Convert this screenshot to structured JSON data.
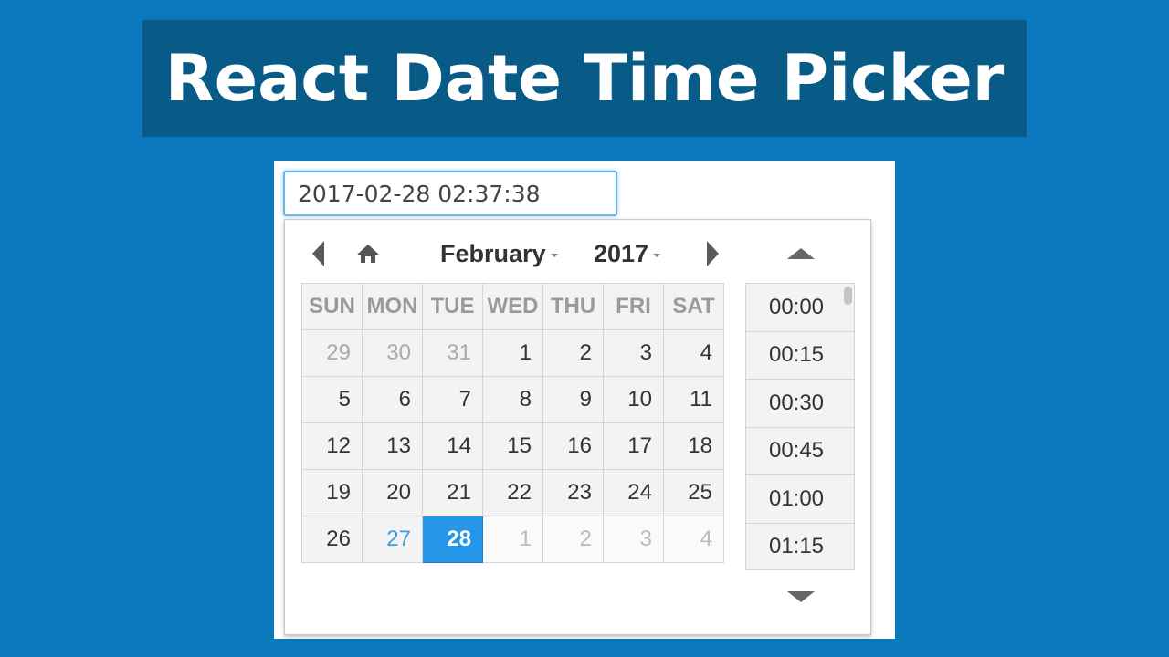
{
  "banner": {
    "title": "React Date Time Picker"
  },
  "input": {
    "value": "2017-02-28 02:37:38"
  },
  "header": {
    "month": "February",
    "year": "2017"
  },
  "calendar": {
    "weekdays": [
      "SUN",
      "MON",
      "TUE",
      "WED",
      "THU",
      "FRI",
      "SAT"
    ],
    "rows": [
      [
        "29",
        "30",
        "31",
        "1",
        "2",
        "3",
        "4"
      ],
      [
        "5",
        "6",
        "7",
        "8",
        "9",
        "10",
        "11"
      ],
      [
        "12",
        "13",
        "14",
        "15",
        "16",
        "17",
        "18"
      ],
      [
        "19",
        "20",
        "21",
        "22",
        "23",
        "24",
        "25"
      ],
      [
        "26",
        "27",
        "28",
        "1",
        "2",
        "3",
        "4"
      ]
    ],
    "today": "27",
    "selected": "28"
  },
  "times": [
    "00:00",
    "00:15",
    "00:30",
    "00:45",
    "01:00",
    "01:15"
  ],
  "icons": {
    "prev": "chevron-left-icon",
    "home": "home-icon",
    "next": "chevron-right-icon",
    "time_up": "triangle-up-icon",
    "time_down": "triangle-down-icon"
  },
  "colors": {
    "background": "#0b78bd",
    "banner": "#085a87",
    "selected_day": "#2596e8",
    "today_text": "#3b9fe0"
  }
}
